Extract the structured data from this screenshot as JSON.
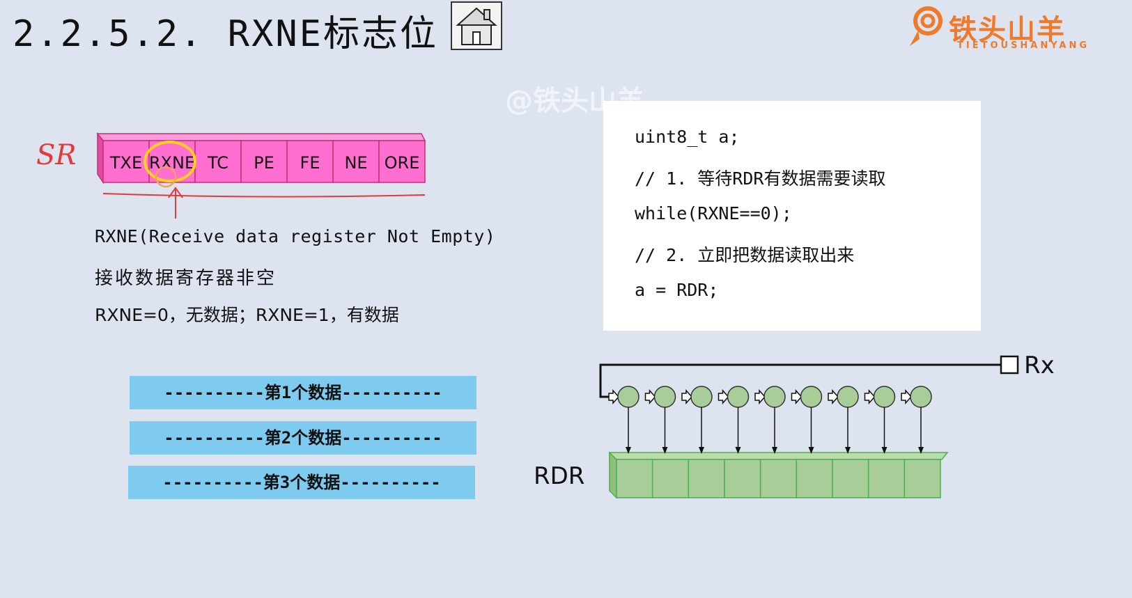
{
  "title": "2.2.5.2. RXNE标志位",
  "logo": {
    "main": "铁头山羊",
    "sub": "TIETOUSHANYANG"
  },
  "watermark": "@铁头山羊",
  "register": {
    "label": "SR",
    "bits": [
      "TXE",
      "RXNE",
      "TC",
      "PE",
      "FE",
      "NE",
      "ORE"
    ],
    "highlighted_bit": "RXNE"
  },
  "description": {
    "english": "RXNE(Receive data register Not Empty)",
    "chinese": "接收数据寄存器非空",
    "values": "RXNE=0，无数据；RXNE=1，有数据"
  },
  "data_bars": [
    {
      "label": "----------第1个数据----------"
    },
    {
      "label": "----------第2个数据----------"
    },
    {
      "label": "----------第3个数据----------"
    }
  ],
  "code": [
    "uint8_t a;",
    "// 1. 等待RDR有数据需要读取",
    "while(RXNE==0);",
    "// 2. 立即把数据读取出来",
    "a = RDR;"
  ],
  "shift_register": {
    "input_label": "Rx",
    "output_label": "RDR",
    "stages": 9
  },
  "colors": {
    "register_fill": "#ff6fd0",
    "register_top": "#ff9be0",
    "highlight_ring": "#ffd21f",
    "annotation_red": "#e23a3a",
    "data_bar": "#7ecbef",
    "rdr_fill": "#a8cd98",
    "rdr_border": "#4caf50",
    "bit_circle": "#a8cd98"
  },
  "icons": {
    "home": "home-icon"
  }
}
